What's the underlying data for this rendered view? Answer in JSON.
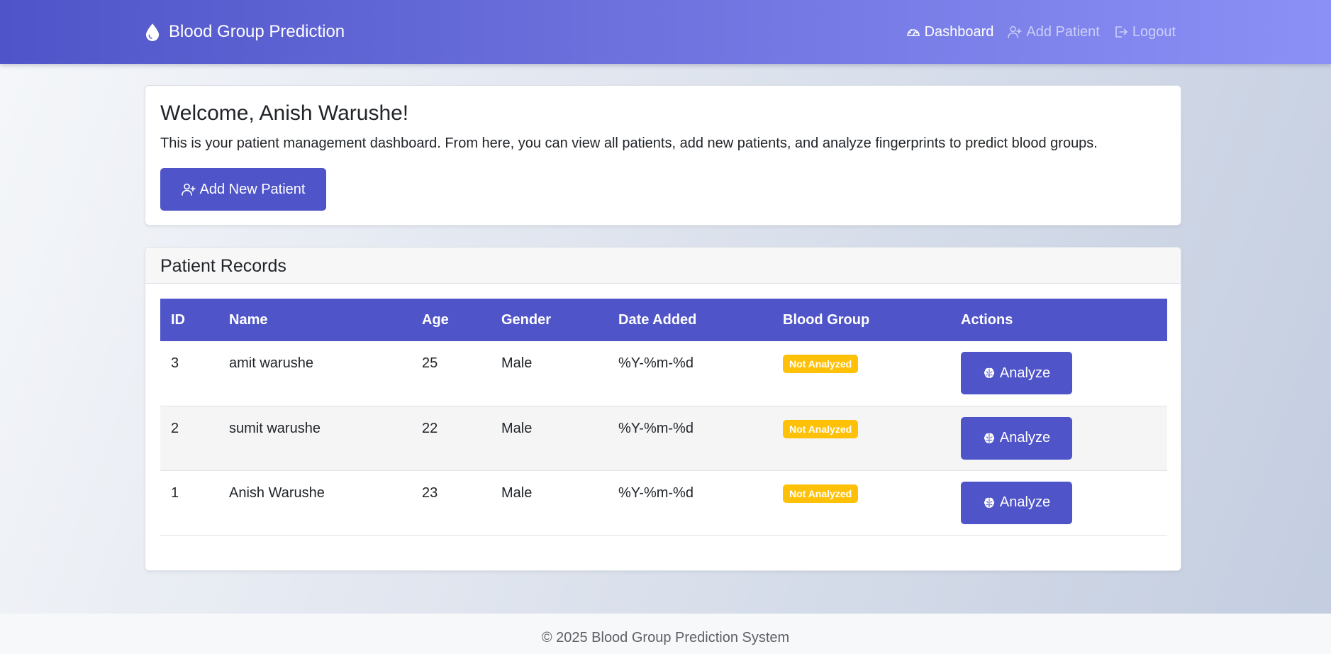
{
  "navbar": {
    "brand": "Blood Group Prediction",
    "brand_icon": "droplet-icon",
    "links": [
      {
        "label": "Dashboard",
        "icon": "speedometer-icon",
        "active": true
      },
      {
        "label": "Add Patient",
        "icon": "person-plus-icon",
        "active": false
      },
      {
        "label": "Logout",
        "icon": "logout-icon",
        "active": false
      }
    ]
  },
  "welcome": {
    "title": "Welcome, Anish Warushe!",
    "text": "This is your patient management dashboard. From here, you can view all patients, add new patients, and analyze fingerprints to predict blood groups.",
    "add_button": "Add New Patient"
  },
  "records": {
    "title": "Patient Records",
    "columns": [
      "ID",
      "Name",
      "Age",
      "Gender",
      "Date Added",
      "Blood Group",
      "Actions"
    ],
    "rows": [
      {
        "id": "3",
        "name": "amit warushe",
        "age": "25",
        "gender": "Male",
        "date": "%Y-%m-%d",
        "blood_group": "Not Analyzed",
        "action": "Analyze"
      },
      {
        "id": "2",
        "name": "sumit warushe",
        "age": "22",
        "gender": "Male",
        "date": "%Y-%m-%d",
        "blood_group": "Not Analyzed",
        "action": "Analyze"
      },
      {
        "id": "1",
        "name": "Anish Warushe",
        "age": "23",
        "gender": "Male",
        "date": "%Y-%m-%d",
        "blood_group": "Not Analyzed",
        "action": "Analyze"
      }
    ]
  },
  "footer": {
    "text": "© 2025 Blood Group Prediction System"
  },
  "colors": {
    "primary": "#4f54c8",
    "badge_warning": "#ffc107"
  }
}
